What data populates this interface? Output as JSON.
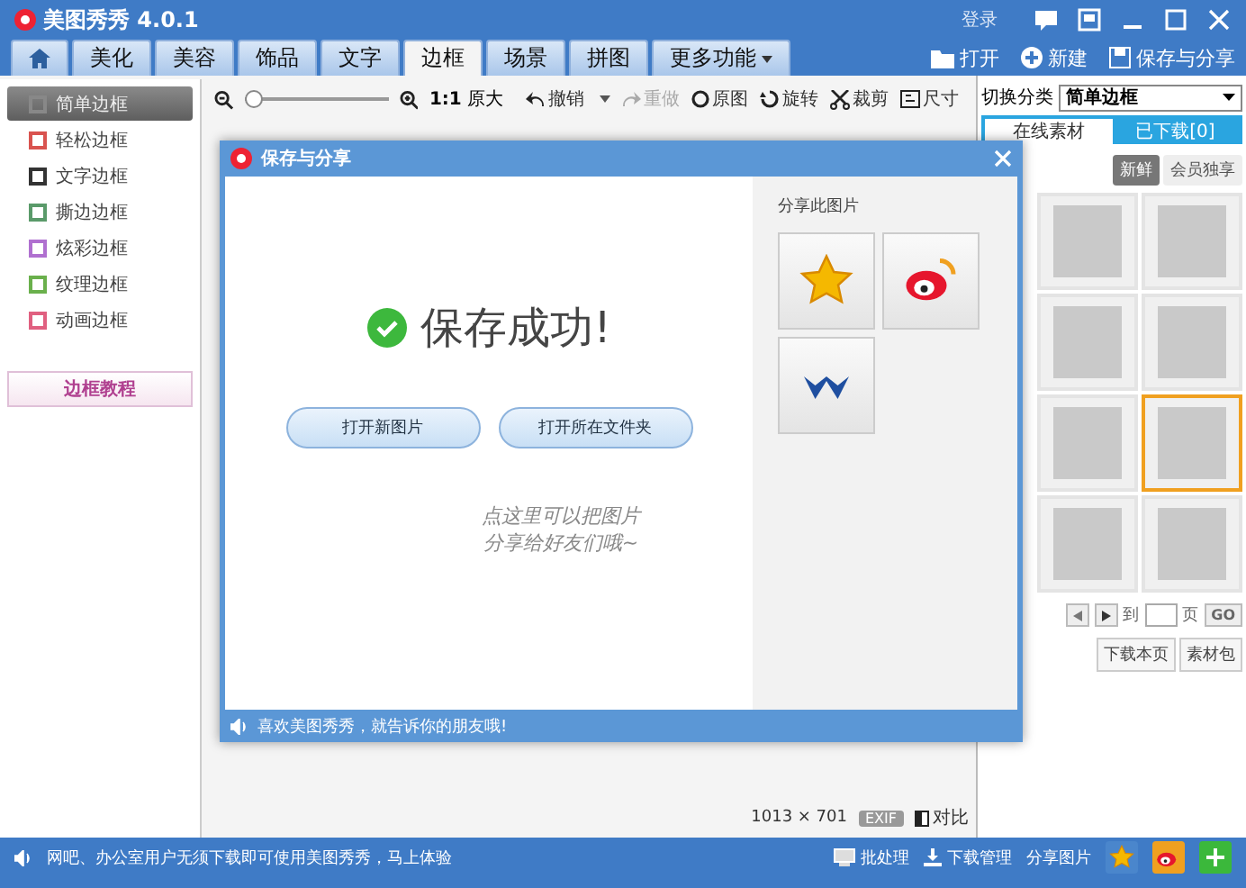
{
  "window": {
    "title": "美图秀秀 4.0.1",
    "login": "登录"
  },
  "tabs": [
    {
      "label": "美化",
      "selected": false
    },
    {
      "label": "美容",
      "selected": false
    },
    {
      "label": "饰品",
      "selected": false
    },
    {
      "label": "文字",
      "selected": false
    },
    {
      "label": "边框",
      "selected": true
    },
    {
      "label": "场景",
      "selected": false
    },
    {
      "label": "拼图",
      "selected": false
    },
    {
      "label": "更多功能",
      "selected": false,
      "dropdown": true
    }
  ],
  "file_actions": [
    {
      "kind": "open",
      "label": "打开"
    },
    {
      "kind": "new",
      "label": "新建"
    },
    {
      "kind": "save",
      "label": "保存与分享"
    }
  ],
  "toolbar": {
    "zoom": {
      "level": 0
    },
    "actual_size": "1:1",
    "actual_size_label": "原大",
    "actions": [
      {
        "kind": "undo",
        "label": "撤销",
        "disabled": false,
        "dropdown": true
      },
      {
        "kind": "redo",
        "label": "重做",
        "disabled": true,
        "dropdown": false
      },
      {
        "kind": "original",
        "label": "原图",
        "disabled": false,
        "dropdown": false
      },
      {
        "kind": "rotate",
        "label": "旋转",
        "disabled": false,
        "dropdown": false
      },
      {
        "kind": "crop",
        "label": "裁剪",
        "disabled": false,
        "dropdown": false
      },
      {
        "kind": "size",
        "label": "尺寸",
        "disabled": false,
        "dropdown": false
      }
    ],
    "category_label": "切换分类",
    "category": "简单边框"
  },
  "sidebar": {
    "items": [
      {
        "label": "简单边框",
        "selected": true,
        "color": "#888888"
      },
      {
        "label": "轻松边框",
        "selected": false,
        "color": "#d9534f"
      },
      {
        "label": "文字边框",
        "selected": false,
        "color": "#333333"
      },
      {
        "label": "撕边边框",
        "selected": false,
        "color": "#5a9a6a"
      },
      {
        "label": "炫彩边框",
        "selected": false,
        "color": "#b070d0"
      },
      {
        "label": "纹理边框",
        "selected": false,
        "color": "#6ab04c"
      },
      {
        "label": "动画边框",
        "selected": false,
        "color": "#e06080"
      }
    ],
    "tutorial": "边框教程"
  },
  "canvas": {
    "dimensions": "1013 × 701",
    "exif": "EXIF",
    "compare": "对比"
  },
  "right_panel": {
    "tabs": [
      {
        "label": "在线素材",
        "selected": true
      },
      {
        "label": "已下载[0]",
        "selected": false
      }
    ],
    "filters": [
      {
        "label": "新鲜",
        "selected": true
      },
      {
        "label": "会员独享",
        "selected": false
      }
    ],
    "thumbnails": [
      {
        "selected": false
      },
      {
        "selected": false
      },
      {
        "selected": false
      },
      {
        "selected": false
      },
      {
        "selected": false
      },
      {
        "selected": true
      },
      {
        "selected": false
      },
      {
        "selected": false
      }
    ],
    "pager": {
      "goto": "到",
      "page": "页",
      "go": "GO"
    },
    "buttons": [
      "下载本页",
      "素材包"
    ]
  },
  "dialog": {
    "title": "保存与分享",
    "message": "保存成功!",
    "buttons": [
      "打开新图片",
      "打开所在文件夹"
    ],
    "note": [
      "点这里可以把图片",
      "分享给好友们哦~"
    ],
    "share_title": "分享此图片",
    "share_targets": [
      {
        "kind": "star"
      },
      {
        "kind": "weibo"
      },
      {
        "kind": "renren"
      }
    ],
    "footer": "喜欢美图秀秀，就告诉你的朋友哦!"
  },
  "status_bar": {
    "message": "网吧、办公室用户无须下载即可使用美图秀秀，马上体验",
    "actions": [
      {
        "kind": "batch",
        "label": "批处理"
      },
      {
        "kind": "download",
        "label": "下载管理"
      },
      {
        "kind": "share",
        "label": "分享图片"
      }
    ],
    "icons": [
      {
        "kind": "star"
      },
      {
        "kind": "weibo"
      },
      {
        "kind": "plus"
      }
    ]
  }
}
